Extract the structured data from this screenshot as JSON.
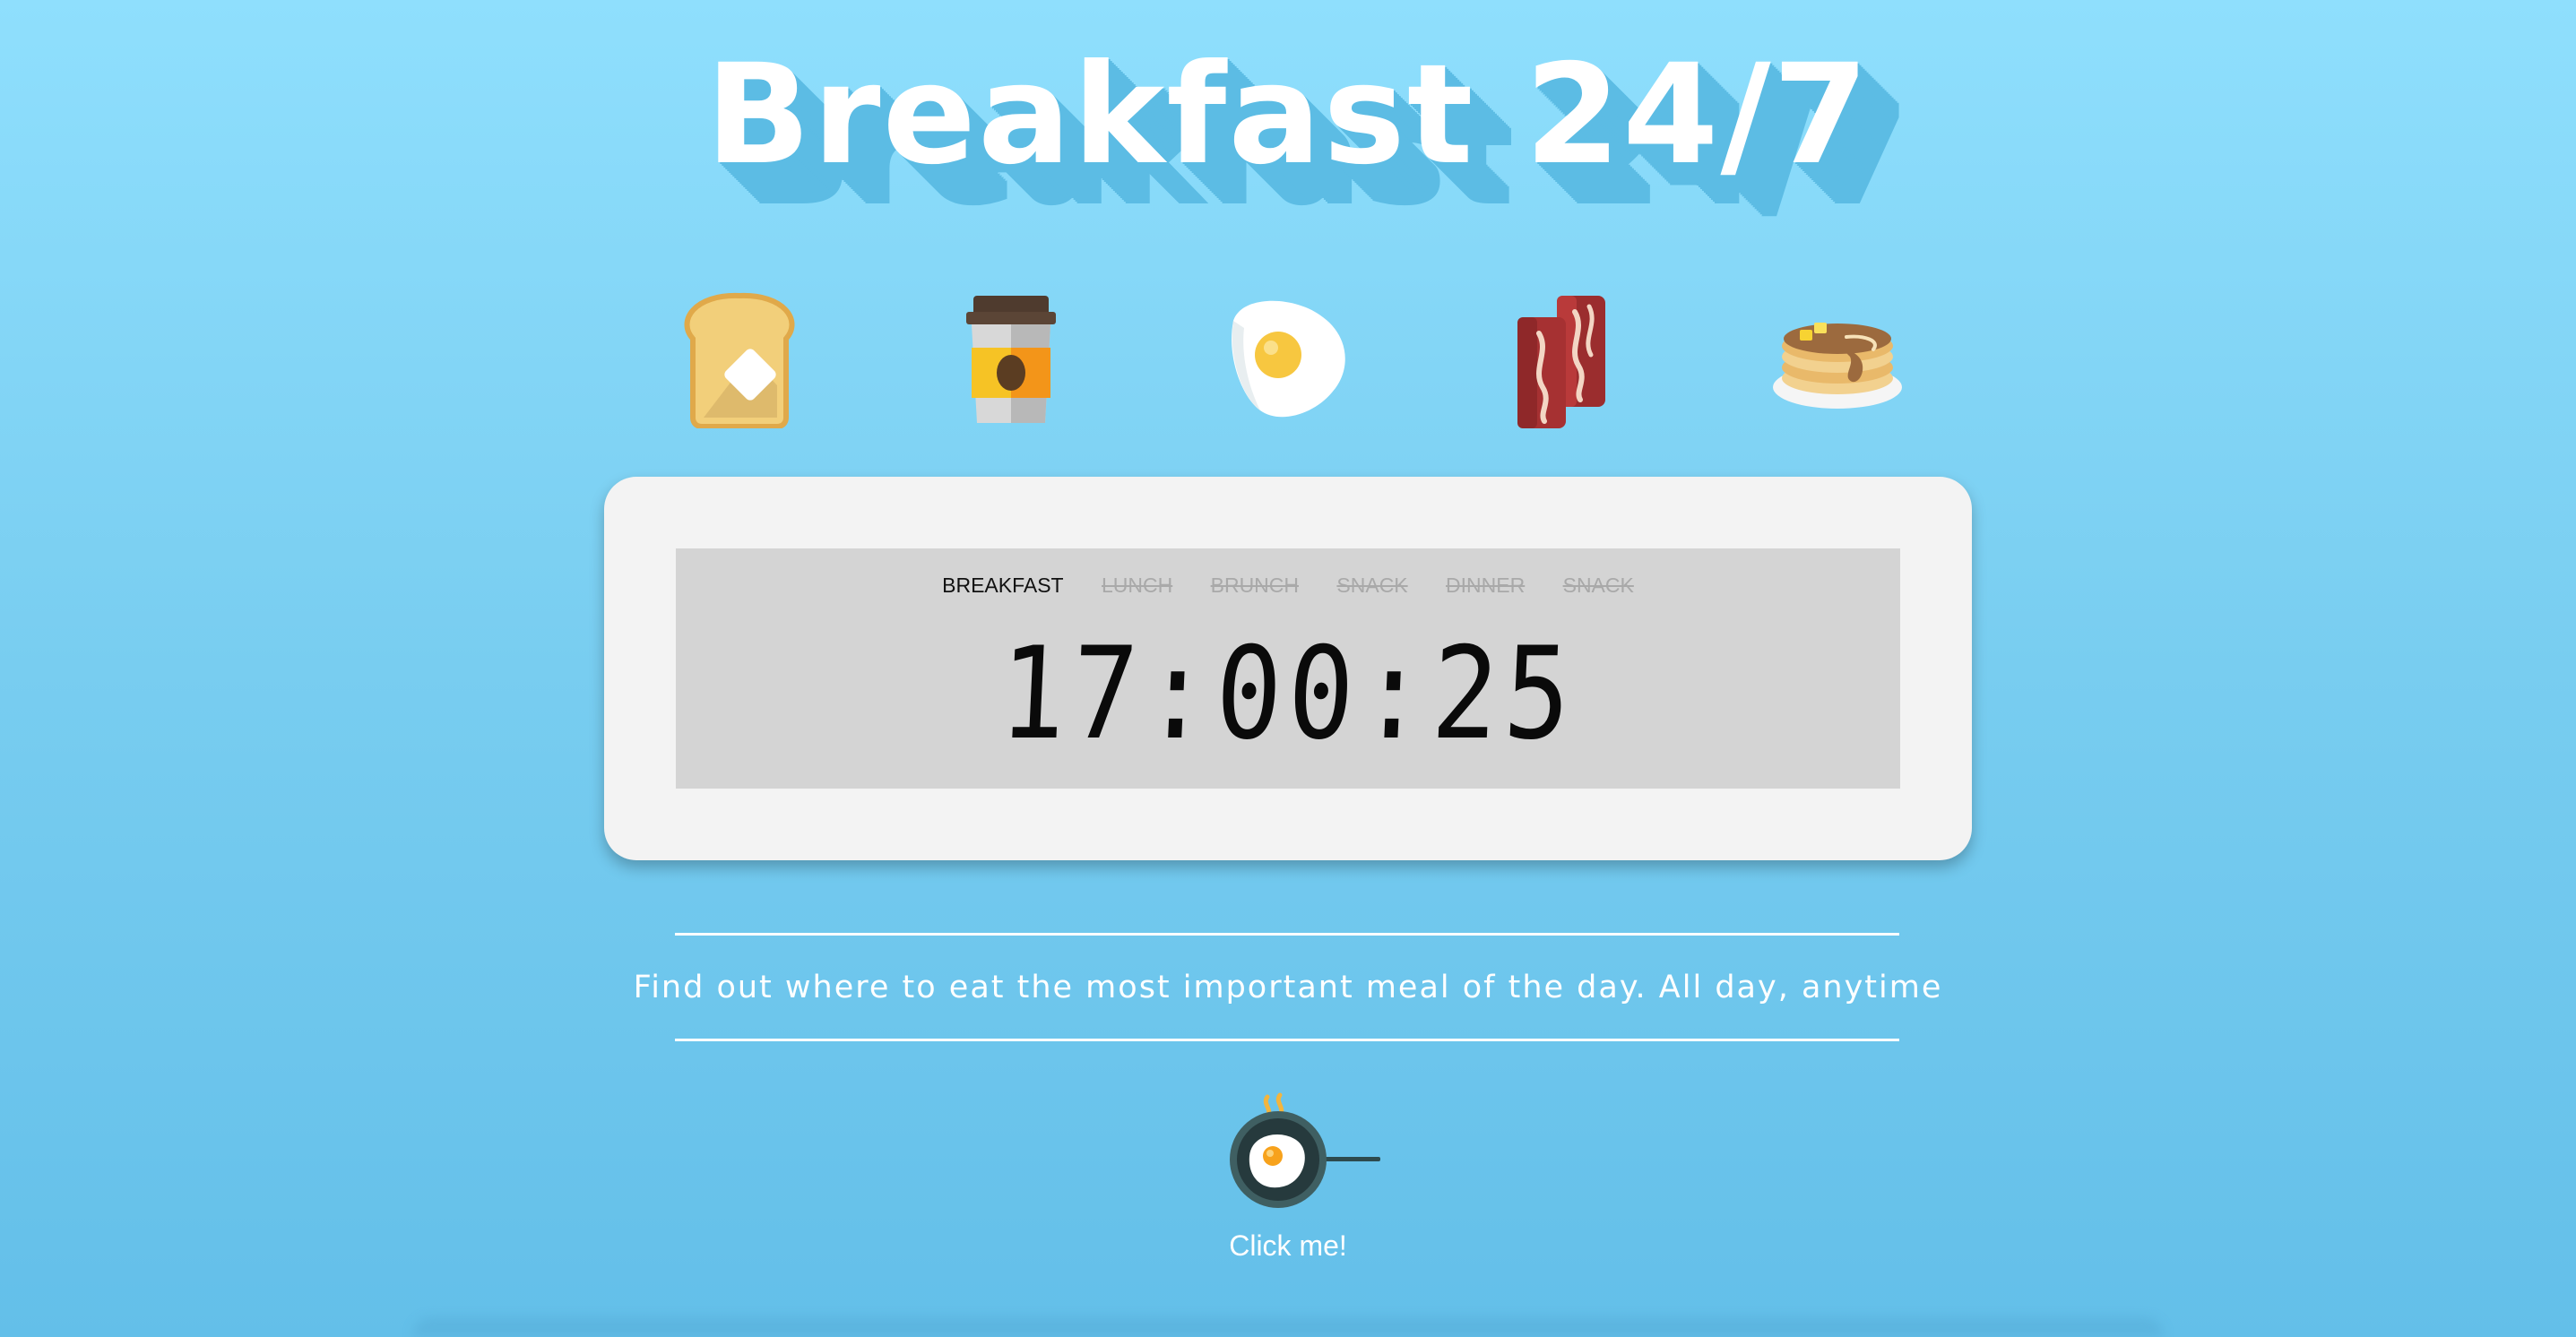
{
  "header": {
    "title": "Breakfast 24/7"
  },
  "icons": [
    "toast-icon",
    "coffee-cup-icon",
    "fried-egg-icon",
    "bacon-icon",
    "pancakes-icon"
  ],
  "clock": {
    "meals": [
      {
        "label": "BREAKFAST",
        "active": true
      },
      {
        "label": "LUNCH",
        "active": false
      },
      {
        "label": "BRUNCH",
        "active": false
      },
      {
        "label": "SNACK",
        "active": false
      },
      {
        "label": "DINNER",
        "active": false
      },
      {
        "label": "SNACK",
        "active": false
      }
    ],
    "time": "17:00:25"
  },
  "tagline": "Find out where to eat the most important meal of the day. All day, anytime",
  "cta": {
    "icon": "frying-pan-egg-icon",
    "label": "Click me!"
  },
  "colors": {
    "background_top": "#8fdffd",
    "background_bottom": "#63bfe9",
    "title_shadow": "#5cbce4",
    "card": "#f3f3f3",
    "display": "#d4d4d4"
  }
}
